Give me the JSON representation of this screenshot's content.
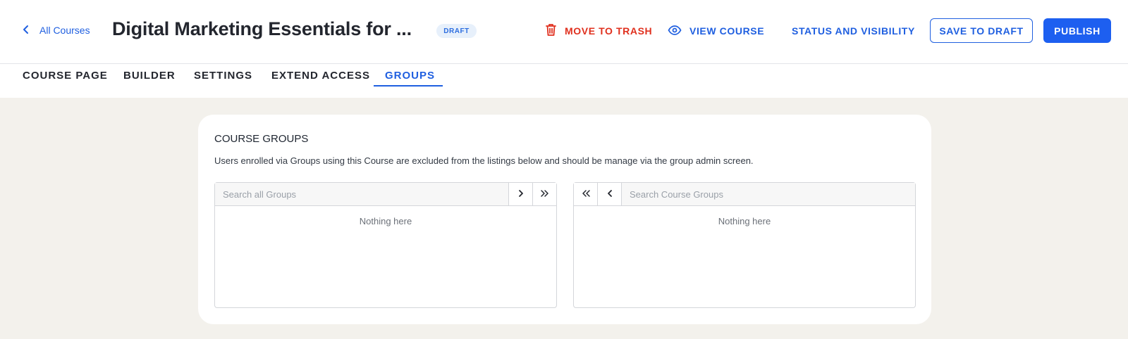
{
  "header": {
    "back_label": "All Courses",
    "title": "Digital Marketing Essentials for ...",
    "badge": "DRAFT",
    "actions": {
      "trash": "MOVE TO TRASH",
      "view": "VIEW COURSE",
      "status": "STATUS AND VISIBILITY",
      "save_draft": "SAVE TO DRAFT",
      "publish": "PUBLISH"
    }
  },
  "tabs": [
    {
      "label": "COURSE PAGE",
      "active": false
    },
    {
      "label": "BUILDER",
      "active": false
    },
    {
      "label": "SETTINGS",
      "active": false
    },
    {
      "label": "EXTEND ACCESS",
      "active": false
    },
    {
      "label": "GROUPS",
      "active": true
    }
  ],
  "groups": {
    "title": "COURSE GROUPS",
    "description": "Users enrolled via Groups using this Course are excluded from the listings below and should be manage via the group admin screen.",
    "available": {
      "placeholder": "Search all Groups",
      "empty": "Nothing here"
    },
    "selected": {
      "placeholder": "Search Course Groups",
      "empty": "Nothing here"
    }
  },
  "colors": {
    "accent": "#1f5fe0",
    "danger": "#e0301e",
    "background": "#f3f1ec"
  },
  "icons": {
    "back": "chevron-left-icon",
    "trash": "trash-icon",
    "view": "eye-icon",
    "add": "chevron-right-icon",
    "add_all": "double-chevron-right-icon",
    "remove": "chevron-left-icon",
    "remove_all": "double-chevron-left-icon"
  }
}
